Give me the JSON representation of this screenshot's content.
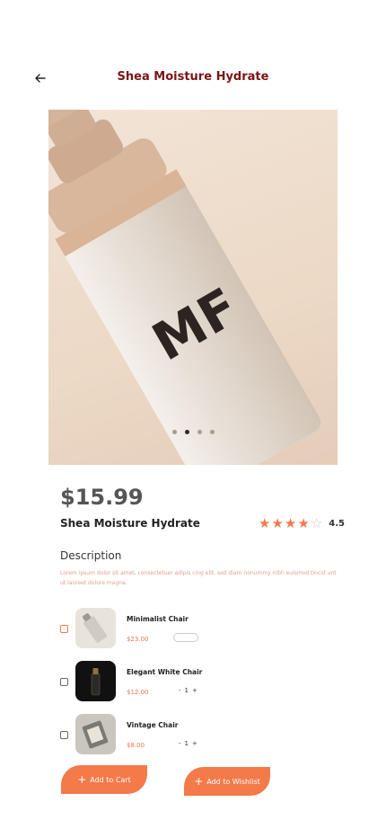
{
  "header": {
    "title": "Shea Moisture Hydrate",
    "back_icon": "arrow-left-icon"
  },
  "product": {
    "price": "$15.99",
    "name": "Shea Moisture Hydrate",
    "rating_value": "4.5",
    "rating_stars": 4.5,
    "carousel_pages": 4,
    "carousel_active": 2
  },
  "description": {
    "heading": "Description",
    "text": "Lorem ipsum dolor sit amet, consectetuer adipis cing elit, sed diam nonummy nibh euismod tincid unt ut laoreet dolore magna."
  },
  "items": [
    {
      "name": "Minimalist Chair",
      "price": "$23.00",
      "quantity": ""
    },
    {
      "name": "Elegant White Chair",
      "price": "$12.00",
      "quantity": "1"
    },
    {
      "name": "Vintage Chair",
      "price": "$8.00",
      "quantity": "1"
    }
  ],
  "actions": {
    "add_to_cart": "Add to Cart",
    "add_to_wishlist": "Add to Wishlist"
  },
  "colors": {
    "accent": "#f47a4a",
    "title": "#7a1414",
    "price_text": "#e8765a",
    "star": "#f27a4a"
  }
}
